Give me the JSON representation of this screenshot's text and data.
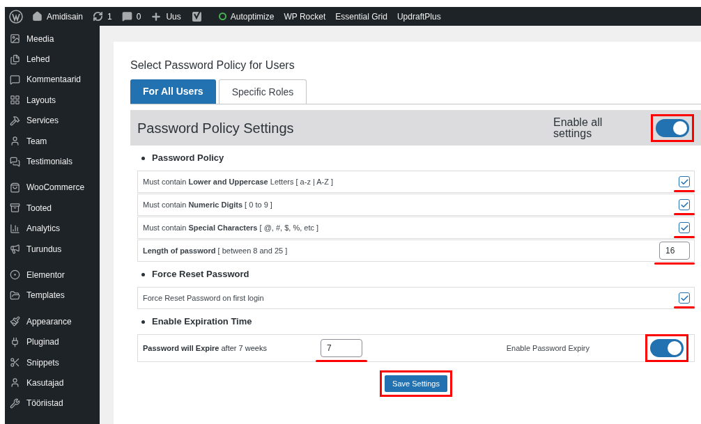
{
  "admin_bar": {
    "items": [
      {
        "kind": "logo"
      },
      {
        "kind": "home",
        "label": "Amidisain"
      },
      {
        "kind": "updates",
        "label": "1"
      },
      {
        "kind": "comments",
        "label": "0"
      },
      {
        "kind": "new",
        "label": "Uus"
      },
      {
        "kind": "seo"
      },
      {
        "kind": "status",
        "label": "Autoptimize",
        "color": "#46b450"
      },
      {
        "kind": "text",
        "label": "WP Rocket"
      },
      {
        "kind": "text",
        "label": "Essential Grid"
      },
      {
        "kind": "text",
        "label": "UpdraftPlus"
      }
    ]
  },
  "sidebar": {
    "groups": [
      {
        "items": [
          "Meedia",
          "Lehed",
          "Kommentaarid",
          "Layouts",
          "Services",
          "Team",
          "Testimonials"
        ]
      },
      {
        "items": [
          "WooCommerce",
          "Tooted",
          "Analytics",
          "Turundus"
        ]
      },
      {
        "items": [
          "Elementor",
          "Templates"
        ]
      },
      {
        "items": [
          "Appearance",
          "Pluginad",
          "Snippets",
          "Kasutajad",
          "Tööriistad"
        ]
      }
    ]
  },
  "page_title": "Select Password Policy for Users",
  "tabs": [
    {
      "label": "For All Users",
      "selected": true
    },
    {
      "label": "Specific Roles",
      "selected": false
    }
  ],
  "panel": {
    "title": "Password Policy Settings",
    "enable_label": "Enable all settings",
    "enable_on": true,
    "enable_boxed": true
  },
  "sections": [
    {
      "title": "Password Policy",
      "rows": [
        {
          "kind": "checkbox",
          "text": "Must contain **Lower and Uppercase** Letters [ a-z | A-Z ]",
          "checked": true,
          "underlined": true
        },
        {
          "kind": "checkbox",
          "text": "Must contain **Numeric Digits** [ 0 to 9 ]",
          "checked": true,
          "underlined": true
        },
        {
          "kind": "checkbox",
          "text": "Must contain **Special Characters** [ @, #, $, %, etc ]",
          "checked": true,
          "underlined": true
        },
        {
          "kind": "number",
          "text": "**Length of password** [ between 8 and 25 ]",
          "value": "16",
          "underlined": true
        }
      ]
    },
    {
      "title": "Force Reset Password",
      "rows": [
        {
          "kind": "checkbox",
          "text": "Force Reset Password on first login",
          "checked": true,
          "underlined": true
        }
      ]
    },
    {
      "title": "Enable Expiration Time",
      "rows": [
        {
          "kind": "expiry",
          "text": "**Password will Expire** after 7 weeks",
          "value": "7",
          "underlined": true,
          "toggle_label": "Enable Password Expiry",
          "toggle_on": true,
          "toggle_boxed": true
        }
      ]
    }
  ],
  "save_button": {
    "label": "Save Settings",
    "boxed": true
  }
}
